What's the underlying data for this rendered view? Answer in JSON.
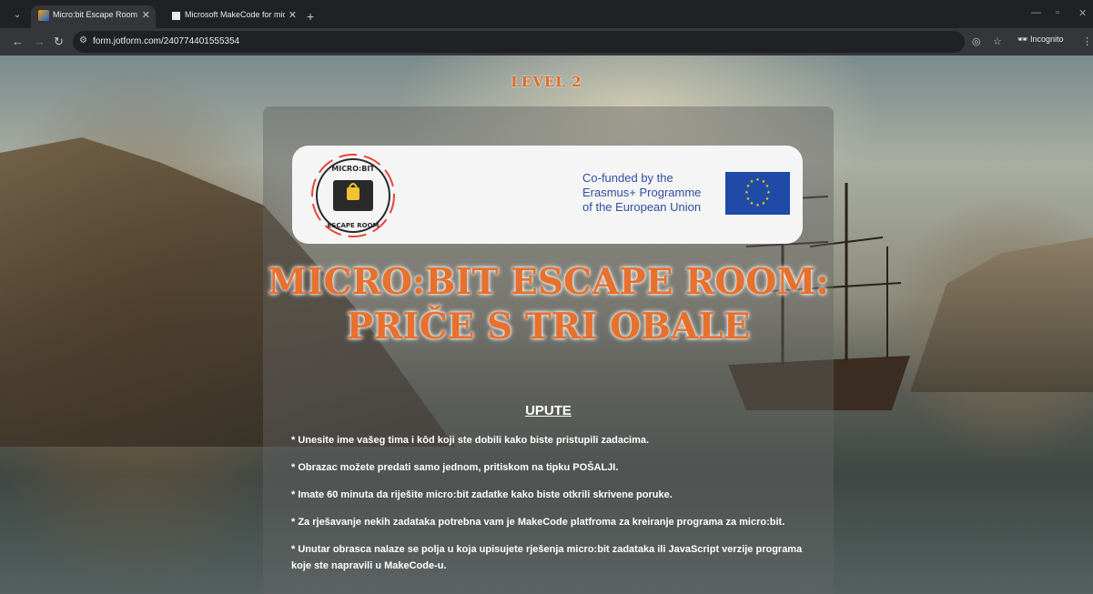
{
  "browser": {
    "tabs": [
      {
        "title": "Micro:bit Escape Room - Level",
        "active": true
      },
      {
        "title": "Microsoft MakeCode for micro",
        "active": false
      }
    ],
    "url": "form.jotform.com/240774401555354",
    "incognito_label": "Incognito"
  },
  "page": {
    "level": "LEVEL 2",
    "logo": {
      "microbit_text": "MICRO:BIT",
      "escape_text": "ESCAPE ROOM",
      "eu_text": [
        "Co-funded by the",
        "Erasmus+ Programme",
        "of the European Union"
      ]
    },
    "headline_line1": "MICRO:BIT ESCAPE ROOM:",
    "headline_line2": "PRIČE S TRI OBALE",
    "instructions_title": "UPUTE",
    "rules": [
      "* Unesite ime vašeg tima i kôd koji ste dobili kako biste pristupili zadacima.",
      "* Obrazac možete predati samo jednom, pritiskom na tipku POŠALJI.",
      "* Imate 60 minuta da riješite micro:bit zadatke kako biste otkrili skrivene poruke.",
      "* Za rješavanje nekih zadataka potrebna vam je MakeCode platfroma za kreiranje programa za micro:bit.",
      "* Unutar obrasca nalaze se polja u koja upisujete rješenja micro:bit zadataka ili JavaScript verzije programa koje ste napravili u MakeCode-u."
    ]
  },
  "colors": {
    "accent": "#e7702d",
    "eu_blue": "#1f4aa8"
  },
  "icons": [
    "tab-search-icon",
    "close-icon",
    "new-tab-icon",
    "back-icon",
    "forward-icon",
    "reload-icon",
    "site-settings-icon",
    "eye-off-icon",
    "star-icon",
    "incognito-icon",
    "menu-icon"
  ]
}
